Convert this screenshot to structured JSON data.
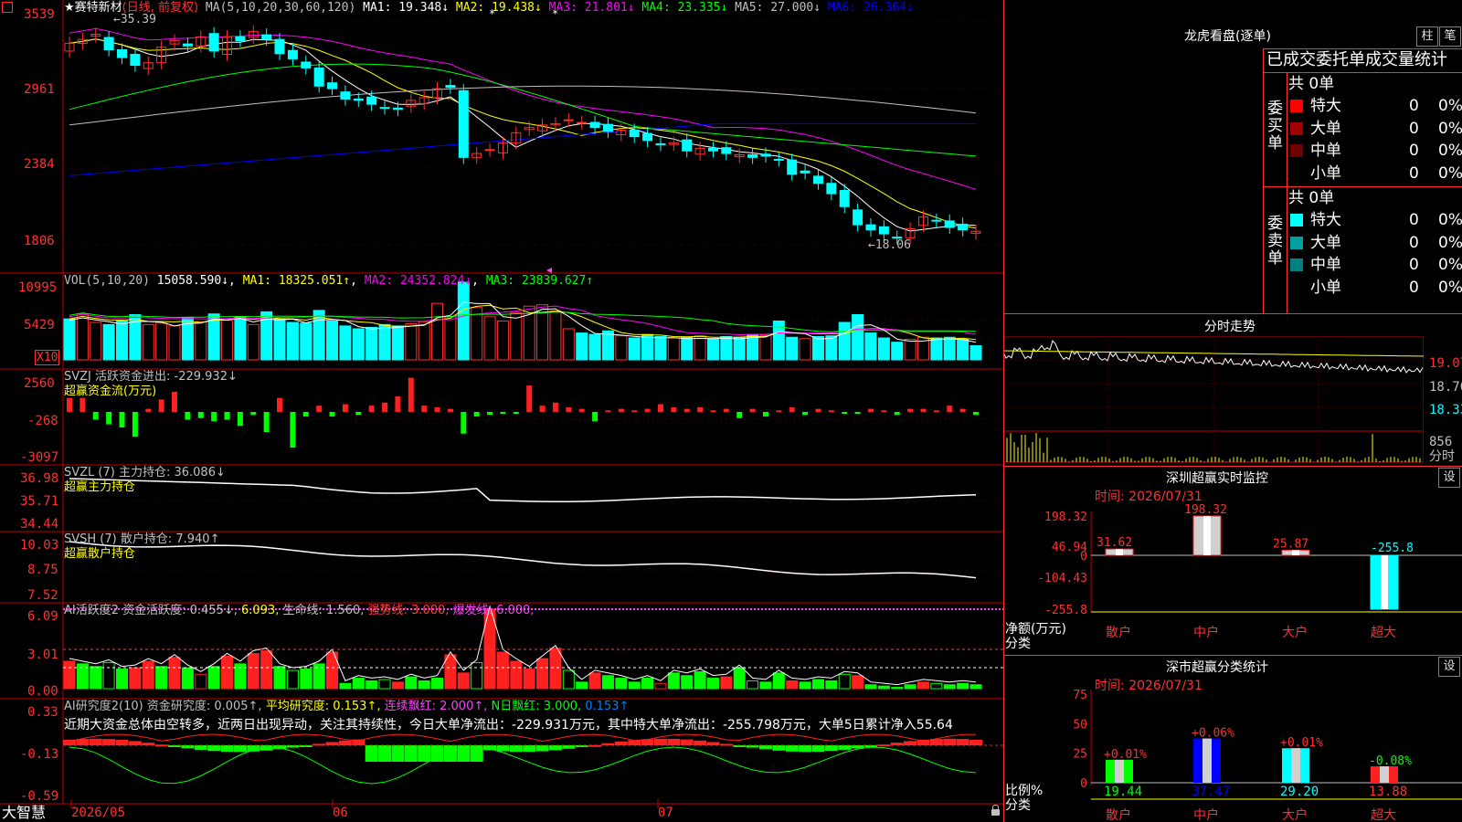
{
  "stock": {
    "star": "★",
    "name": "赛特新材",
    "mode": "(日线, 前复权)"
  },
  "ma_header": {
    "label": "MA(5,10,20,30,60,120)",
    "items": [
      {
        "text": "MA1: 19.348↓",
        "color": "#ffffff"
      },
      {
        "text": "MA2: 19.438↓",
        "color": "#ffff00"
      },
      {
        "text": "MA3: 21.801↓",
        "color": "#ff00ff"
      },
      {
        "text": "MA4: 23.335↓",
        "color": "#00ff00"
      },
      {
        "text": "MA5: 27.000↓",
        "color": "#c0c0c0"
      },
      {
        "text": "MA6: 26.364↓",
        "color": "#0000ff"
      }
    ]
  },
  "price_axis": [
    "3539",
    "2961",
    "2384",
    "1806"
  ],
  "price_marks": {
    "high": "35.39",
    "low": "18.06"
  },
  "vol_header": {
    "label": "VOL(5,10,20)",
    "items": [
      {
        "text": "15058.590↓",
        "color": "#ffffff"
      },
      {
        "text": "MA1: 18325.051↑",
        "color": "#ffff00"
      },
      {
        "text": "MA2: 24352.824↓",
        "color": "#ff00ff"
      },
      {
        "text": "MA3: 23839.627↑",
        "color": "#00ff00"
      }
    ]
  },
  "vol_axis": [
    "10995",
    "5429"
  ],
  "vol_unit": "X10",
  "svzj": {
    "label": "SVZJ 活跃资金进出: -229.932↓",
    "sub": "超赢资金流(万元)",
    "axis": [
      "2560",
      "-268",
      "-3097"
    ]
  },
  "svzl": {
    "label": "SVZL (7) 主力持仓: 36.086↓",
    "sub": "超赢主力持仓",
    "axis": [
      "36.98",
      "35.71",
      "34.44"
    ]
  },
  "svsh": {
    "label": "SVSH (7) 散户持仓: 7.940↑",
    "sub": "超赢散户持仓",
    "axis": [
      "10.03",
      "8.75",
      "7.52"
    ]
  },
  "ai1": {
    "items": [
      {
        "text": "AI活跃度2 资金活跃度: 0.455↓,",
        "color": "#c0c0c0"
      },
      {
        "text": "6.093,",
        "color": "#ffff00"
      },
      {
        "text": "生命线: 1.560,",
        "color": "#c0c0c0"
      },
      {
        "text": "强势线: 3.000,",
        "color": "#ff4040"
      },
      {
        "text": "爆发线: 6.000,",
        "color": "#ff40ff"
      }
    ],
    "axis": [
      "6.09",
      "3.01",
      "0.00"
    ]
  },
  "ai2": {
    "items": [
      {
        "text": "AI研究度2(10) 资金研究度: 0.005↑,",
        "color": "#c0c0c0"
      },
      {
        "text": "平均研究度: 0.153↑,",
        "color": "#ffff00"
      },
      {
        "text": "连续飘红: 2.000↑,",
        "color": "#ff40ff"
      },
      {
        "text": "N日飘红: 3.000,",
        "color": "#00ff00"
      },
      {
        "text": "0.153↑",
        "color": "#0080ff"
      }
    ],
    "axis": [
      "0.33",
      "-0.13",
      "-0.59"
    ],
    "comment": "近期大资金总体由空转多，近两日出现异动，关注其持续性，今日大单净流出：-229.931万元，其中特大单净流出：-255.798万元，大单5日累计净入55.64"
  },
  "date_axis": {
    "brand": "大智慧",
    "labels": [
      "2026/05",
      "06",
      "07"
    ]
  },
  "lhb": {
    "title": "龙虎看盘(逐单)",
    "btn1": "柱",
    "btn2": "笔",
    "stat_title": "已成交委托单成交量统计",
    "buy_label": "委买单",
    "sell_label": "委卖单",
    "buy": {
      "total": "共 0单",
      "rows": [
        {
          "name": "特大",
          "n": "0",
          "p": "0%",
          "color": "#ff0000"
        },
        {
          "name": "大单",
          "n": "0",
          "p": "0%",
          "color": "#a00000"
        },
        {
          "name": "中单",
          "n": "0",
          "p": "0%",
          "color": "#700000"
        },
        {
          "name": "小单",
          "n": "0",
          "p": "0%",
          "color": ""
        }
      ]
    },
    "sell": {
      "total": "共 0单",
      "rows": [
        {
          "name": "特大",
          "n": "0",
          "p": "0%",
          "color": "#00ffff"
        },
        {
          "name": "大单",
          "n": "0",
          "p": "0%",
          "color": "#00a0a0"
        },
        {
          "name": "中单",
          "n": "0",
          "p": "0%",
          "color": "#008080"
        },
        {
          "name": "小单",
          "n": "0",
          "p": "0%",
          "color": ""
        }
      ]
    }
  },
  "fenshi": {
    "title": "分时走势",
    "axis": [
      "19.07",
      "18.70",
      "18.33"
    ],
    "vol_axis": [
      "856",
      "分时"
    ]
  },
  "monitor": {
    "title": "深圳超赢实时监控",
    "btn": "设",
    "time": "时间: 2026/07/31",
    "axis": [
      "198.32",
      "46.94",
      "0",
      "-104.43",
      "-255.8"
    ],
    "ylabel": "净额(万元)",
    "xlabel": "分类",
    "bars": [
      {
        "cat": "散户",
        "value": 31.62,
        "label": "31.62"
      },
      {
        "cat": "中户",
        "value": 198.32,
        "label": "198.32"
      },
      {
        "cat": "大户",
        "value": 25.87,
        "label": "25.87"
      },
      {
        "cat": "超大",
        "value": -255.8,
        "label": "-255.8"
      }
    ]
  },
  "classify": {
    "title": "深市超赢分类统计",
    "btn": "设",
    "time": "时间: 2026/07/31",
    "axis": [
      "75",
      "50",
      "25",
      "0"
    ],
    "ylabel": "比例%",
    "xlabel": "分类",
    "bars": [
      {
        "cat": "散户",
        "value": 19.44,
        "label": "19.44",
        "delta": "+0.01%"
      },
      {
        "cat": "中户",
        "value": 37.47,
        "label": "37.47",
        "delta": "+0.06%"
      },
      {
        "cat": "大户",
        "value": 29.2,
        "label": "29.20",
        "delta": "+0.01%"
      },
      {
        "cat": "超大",
        "value": 13.88,
        "label": "13.88",
        "delta": "-0.08%"
      }
    ]
  }
}
